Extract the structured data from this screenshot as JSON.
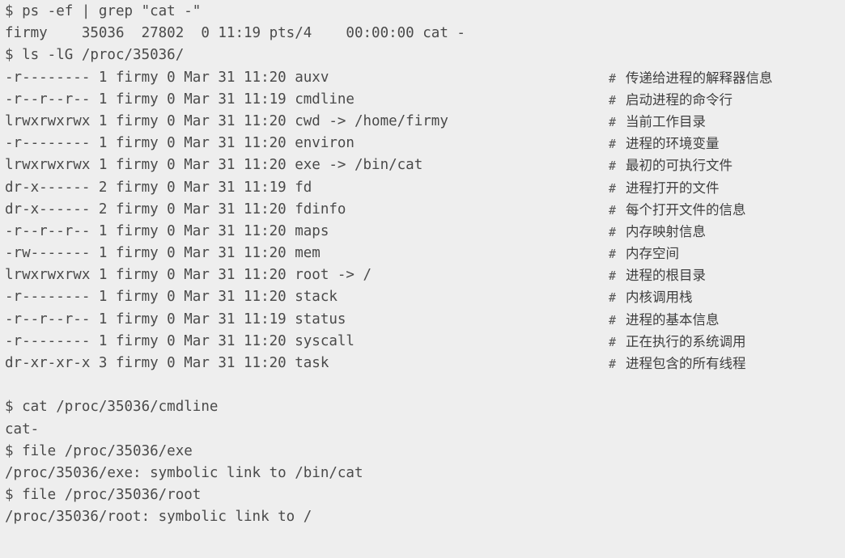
{
  "lines": [
    {
      "code": "$ ps -ef | grep \"cat -\""
    },
    {
      "code": "firmy    35036  27802  0 11:19 pts/4    00:00:00 cat -"
    },
    {
      "code": "$ ls -lG /proc/35036/"
    },
    {
      "code": "-r-------- 1 firmy 0 Mar 31 11:20 auxv",
      "mark": "#",
      "comment": "传递给进程的解释器信息"
    },
    {
      "code": "-r--r--r-- 1 firmy 0 Mar 31 11:19 cmdline",
      "mark": "#",
      "comment": "启动进程的命令行"
    },
    {
      "code": "lrwxrwxrwx 1 firmy 0 Mar 31 11:20 cwd -> /home/firmy",
      "mark": "#",
      "comment": "当前工作目录"
    },
    {
      "code": "-r-------- 1 firmy 0 Mar 31 11:20 environ",
      "mark": "#",
      "comment": "进程的环境变量"
    },
    {
      "code": "lrwxrwxrwx 1 firmy 0 Mar 31 11:20 exe -> /bin/cat",
      "mark": "#",
      "comment": "最初的可执行文件"
    },
    {
      "code": "dr-x------ 2 firmy 0 Mar 31 11:19 fd",
      "mark": "#",
      "comment": "进程打开的文件"
    },
    {
      "code": "dr-x------ 2 firmy 0 Mar 31 11:20 fdinfo",
      "mark": "#",
      "comment": "每个打开文件的信息"
    },
    {
      "code": "-r--r--r-- 1 firmy 0 Mar 31 11:20 maps",
      "mark": "#",
      "comment": "内存映射信息"
    },
    {
      "code": "-rw------- 1 firmy 0 Mar 31 11:20 mem",
      "mark": "#",
      "comment": "内存空间"
    },
    {
      "code": "lrwxrwxrwx 1 firmy 0 Mar 31 11:20 root -> /",
      "mark": "#",
      "comment": "进程的根目录"
    },
    {
      "code": "-r-------- 1 firmy 0 Mar 31 11:20 stack",
      "mark": "#",
      "comment": "内核调用栈"
    },
    {
      "code": "-r--r--r-- 1 firmy 0 Mar 31 11:19 status",
      "mark": "#",
      "comment": "进程的基本信息"
    },
    {
      "code": "-r-------- 1 firmy 0 Mar 31 11:20 syscall",
      "mark": "#",
      "comment": "正在执行的系统调用"
    },
    {
      "code": "dr-xr-xr-x 3 firmy 0 Mar 31 11:20 task",
      "mark": "#",
      "comment": "进程包含的所有线程"
    },
    {
      "code": ""
    },
    {
      "code": "$ cat /proc/35036/cmdline"
    },
    {
      "code": "cat-"
    },
    {
      "code": "$ file /proc/35036/exe"
    },
    {
      "code": "/proc/35036/exe: symbolic link to /bin/cat"
    },
    {
      "code": "$ file /proc/35036/root"
    },
    {
      "code": "/proc/35036/root: symbolic link to /"
    }
  ]
}
